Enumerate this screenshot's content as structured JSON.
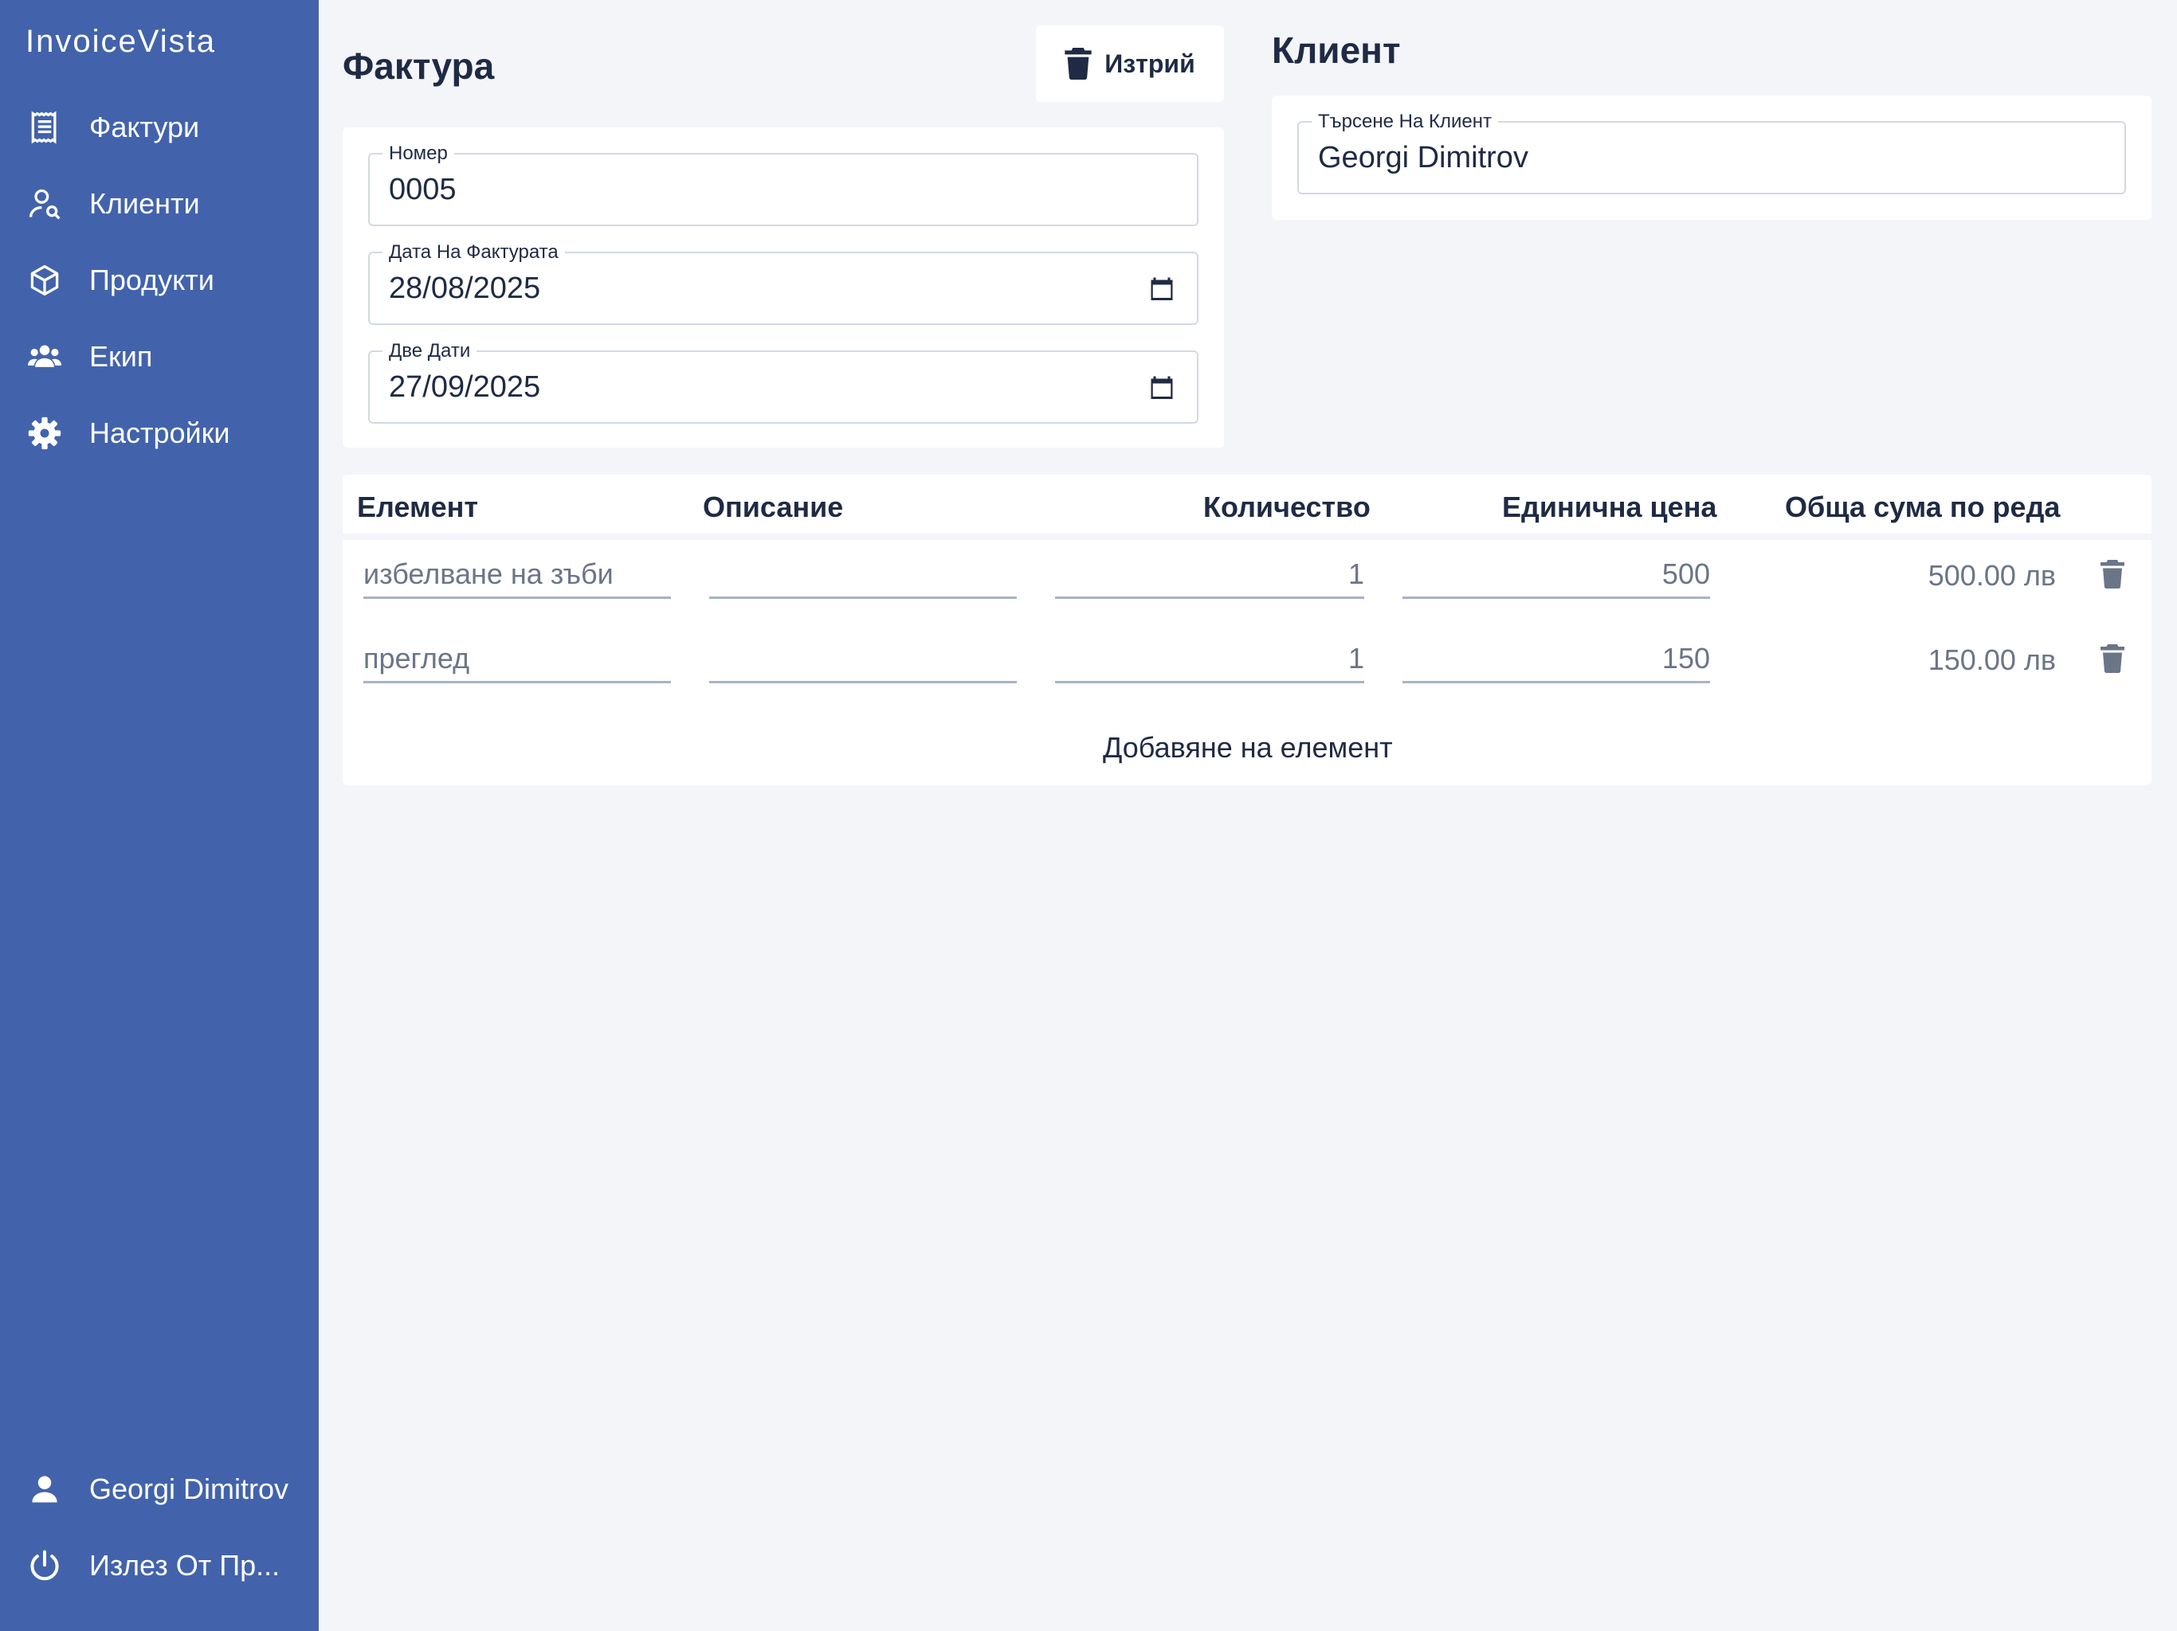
{
  "app": {
    "brand": "InvoiceVista"
  },
  "sidebar": {
    "items": [
      {
        "label": "Фактури",
        "icon": "receipt-icon"
      },
      {
        "label": "Клиенти",
        "icon": "client-search-icon"
      },
      {
        "label": "Продукти",
        "icon": "cube-icon"
      },
      {
        "label": "Екип",
        "icon": "team-icon"
      },
      {
        "label": "Настройки",
        "icon": "gear-icon"
      }
    ],
    "footer": {
      "user": "Georgi Dimitrov",
      "logout": "Излез От Пр..."
    }
  },
  "invoice": {
    "title": "Фактура",
    "delete_label": "Изтрий",
    "number": {
      "label": "Номер",
      "value": "0005"
    },
    "date": {
      "label": "Дата На Фактурата",
      "value": "28/08/2025"
    },
    "due_date": {
      "label": "Две Дати",
      "value": "27/09/2025"
    }
  },
  "client": {
    "title": "Клиент",
    "search": {
      "label": "Търсене На Клиент",
      "value": "Georgi Dimitrov"
    }
  },
  "items_table": {
    "headers": [
      "Елемент",
      "Описание",
      "Количество",
      "Единична цена",
      "Обща сума по реда"
    ],
    "rows": [
      {
        "item": "избелване на зъби",
        "description": "",
        "quantity": "1",
        "unit_price": "500",
        "total": "500.00 лв"
      },
      {
        "item": "преглед",
        "description": "",
        "quantity": "1",
        "unit_price": "150",
        "total": "150.00 лв"
      }
    ],
    "add_label": "Добавяне на елемент"
  },
  "colors": {
    "sidebar": "#4263ab",
    "background": "#f3f5f9",
    "text_dark": "#1f2a44",
    "text_muted": "#6b7588"
  }
}
